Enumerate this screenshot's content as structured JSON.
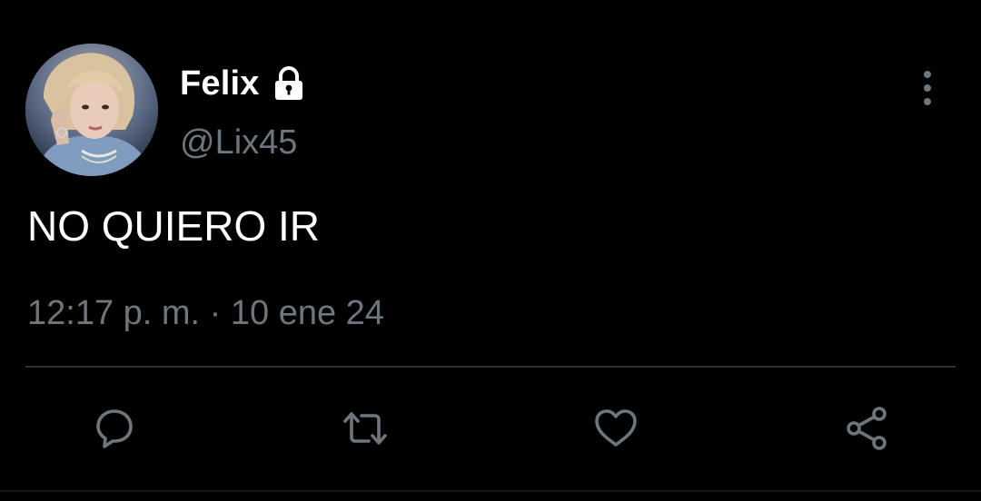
{
  "tweet": {
    "author": {
      "display_name": "Felix",
      "handle": "@Lix45",
      "protected_icon": "lock-icon",
      "avatar": "avatar"
    },
    "text": "NO QUIERO IR",
    "timestamp": "12:17 p. m. · 10 ene 24",
    "more_icon": "more-vertical-icon"
  },
  "actions": [
    {
      "name": "reply",
      "icon": "reply-icon"
    },
    {
      "name": "retweet",
      "icon": "retweet-icon"
    },
    {
      "name": "like",
      "icon": "heart-icon"
    },
    {
      "name": "share",
      "icon": "share-icon"
    }
  ],
  "colors": {
    "background": "#000000",
    "primary_text": "#ffffff",
    "secondary_text": "#6e767d",
    "divider": "#2f3336",
    "icon": "#6e767d"
  }
}
